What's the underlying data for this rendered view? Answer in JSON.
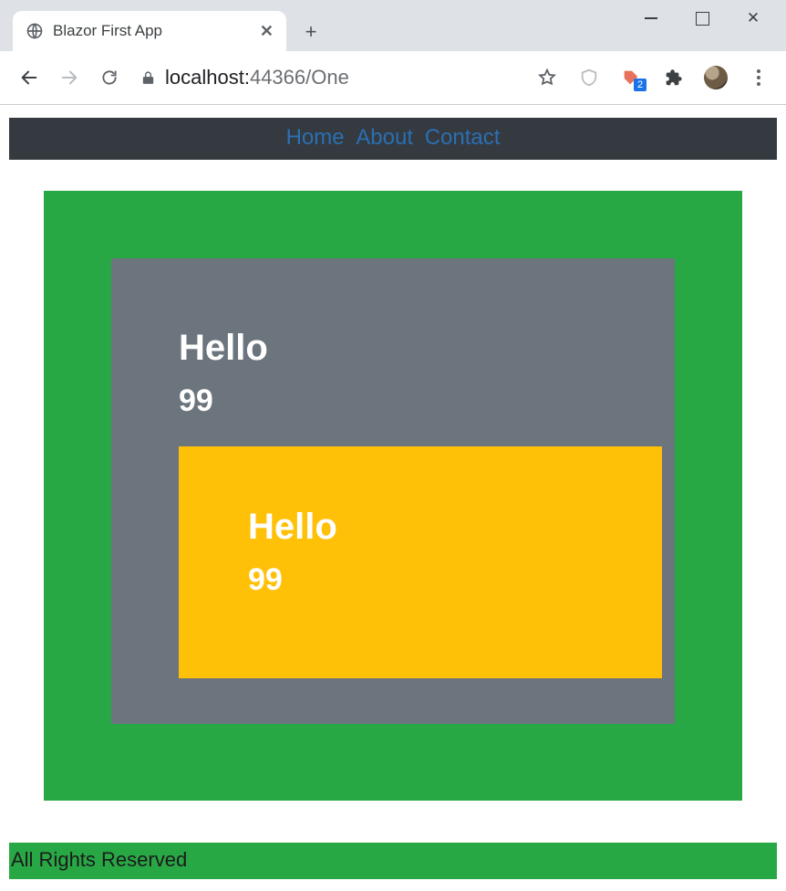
{
  "browser": {
    "tab_title": "Blazor First App",
    "address_host": "localhost:",
    "address_port_path": "44366/One",
    "extension_badge": "2"
  },
  "nav": {
    "home": "Home",
    "about": "About",
    "contact": "Contact"
  },
  "outer": {
    "heading": "Hello",
    "value": "99"
  },
  "inner": {
    "heading": "Hello",
    "value": "99"
  },
  "footer": {
    "text": "All Rights Reserved"
  }
}
